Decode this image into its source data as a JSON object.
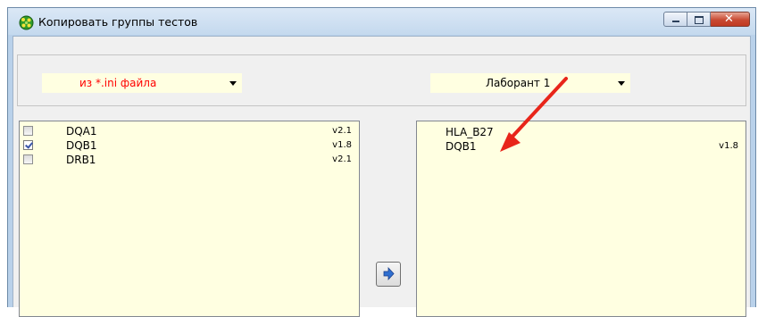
{
  "window": {
    "title": "Копировать группы тестов",
    "controls": {
      "minimize_icon": "minimize-icon",
      "maximize_icon": "maximize-icon",
      "close_icon": "close-icon",
      "close_glyph": "✕"
    }
  },
  "source": {
    "selected": "из *.ini файла",
    "items": [
      {
        "name": "DQA1",
        "version": "v2.1",
        "checked": false
      },
      {
        "name": "DQB1",
        "version": "v1.8",
        "checked": true
      },
      {
        "name": "DRB1",
        "version": "v2.1",
        "checked": false
      }
    ]
  },
  "target": {
    "selected": "Лаборант 1",
    "items": [
      {
        "name": "HLA_B27",
        "version": ""
      },
      {
        "name": "DQB1",
        "version": "v1.8"
      }
    ]
  },
  "colors": {
    "source_combo_text": "#ff0000",
    "annotation_arrow": "#e8251a",
    "list_background": "#ffffe1"
  }
}
